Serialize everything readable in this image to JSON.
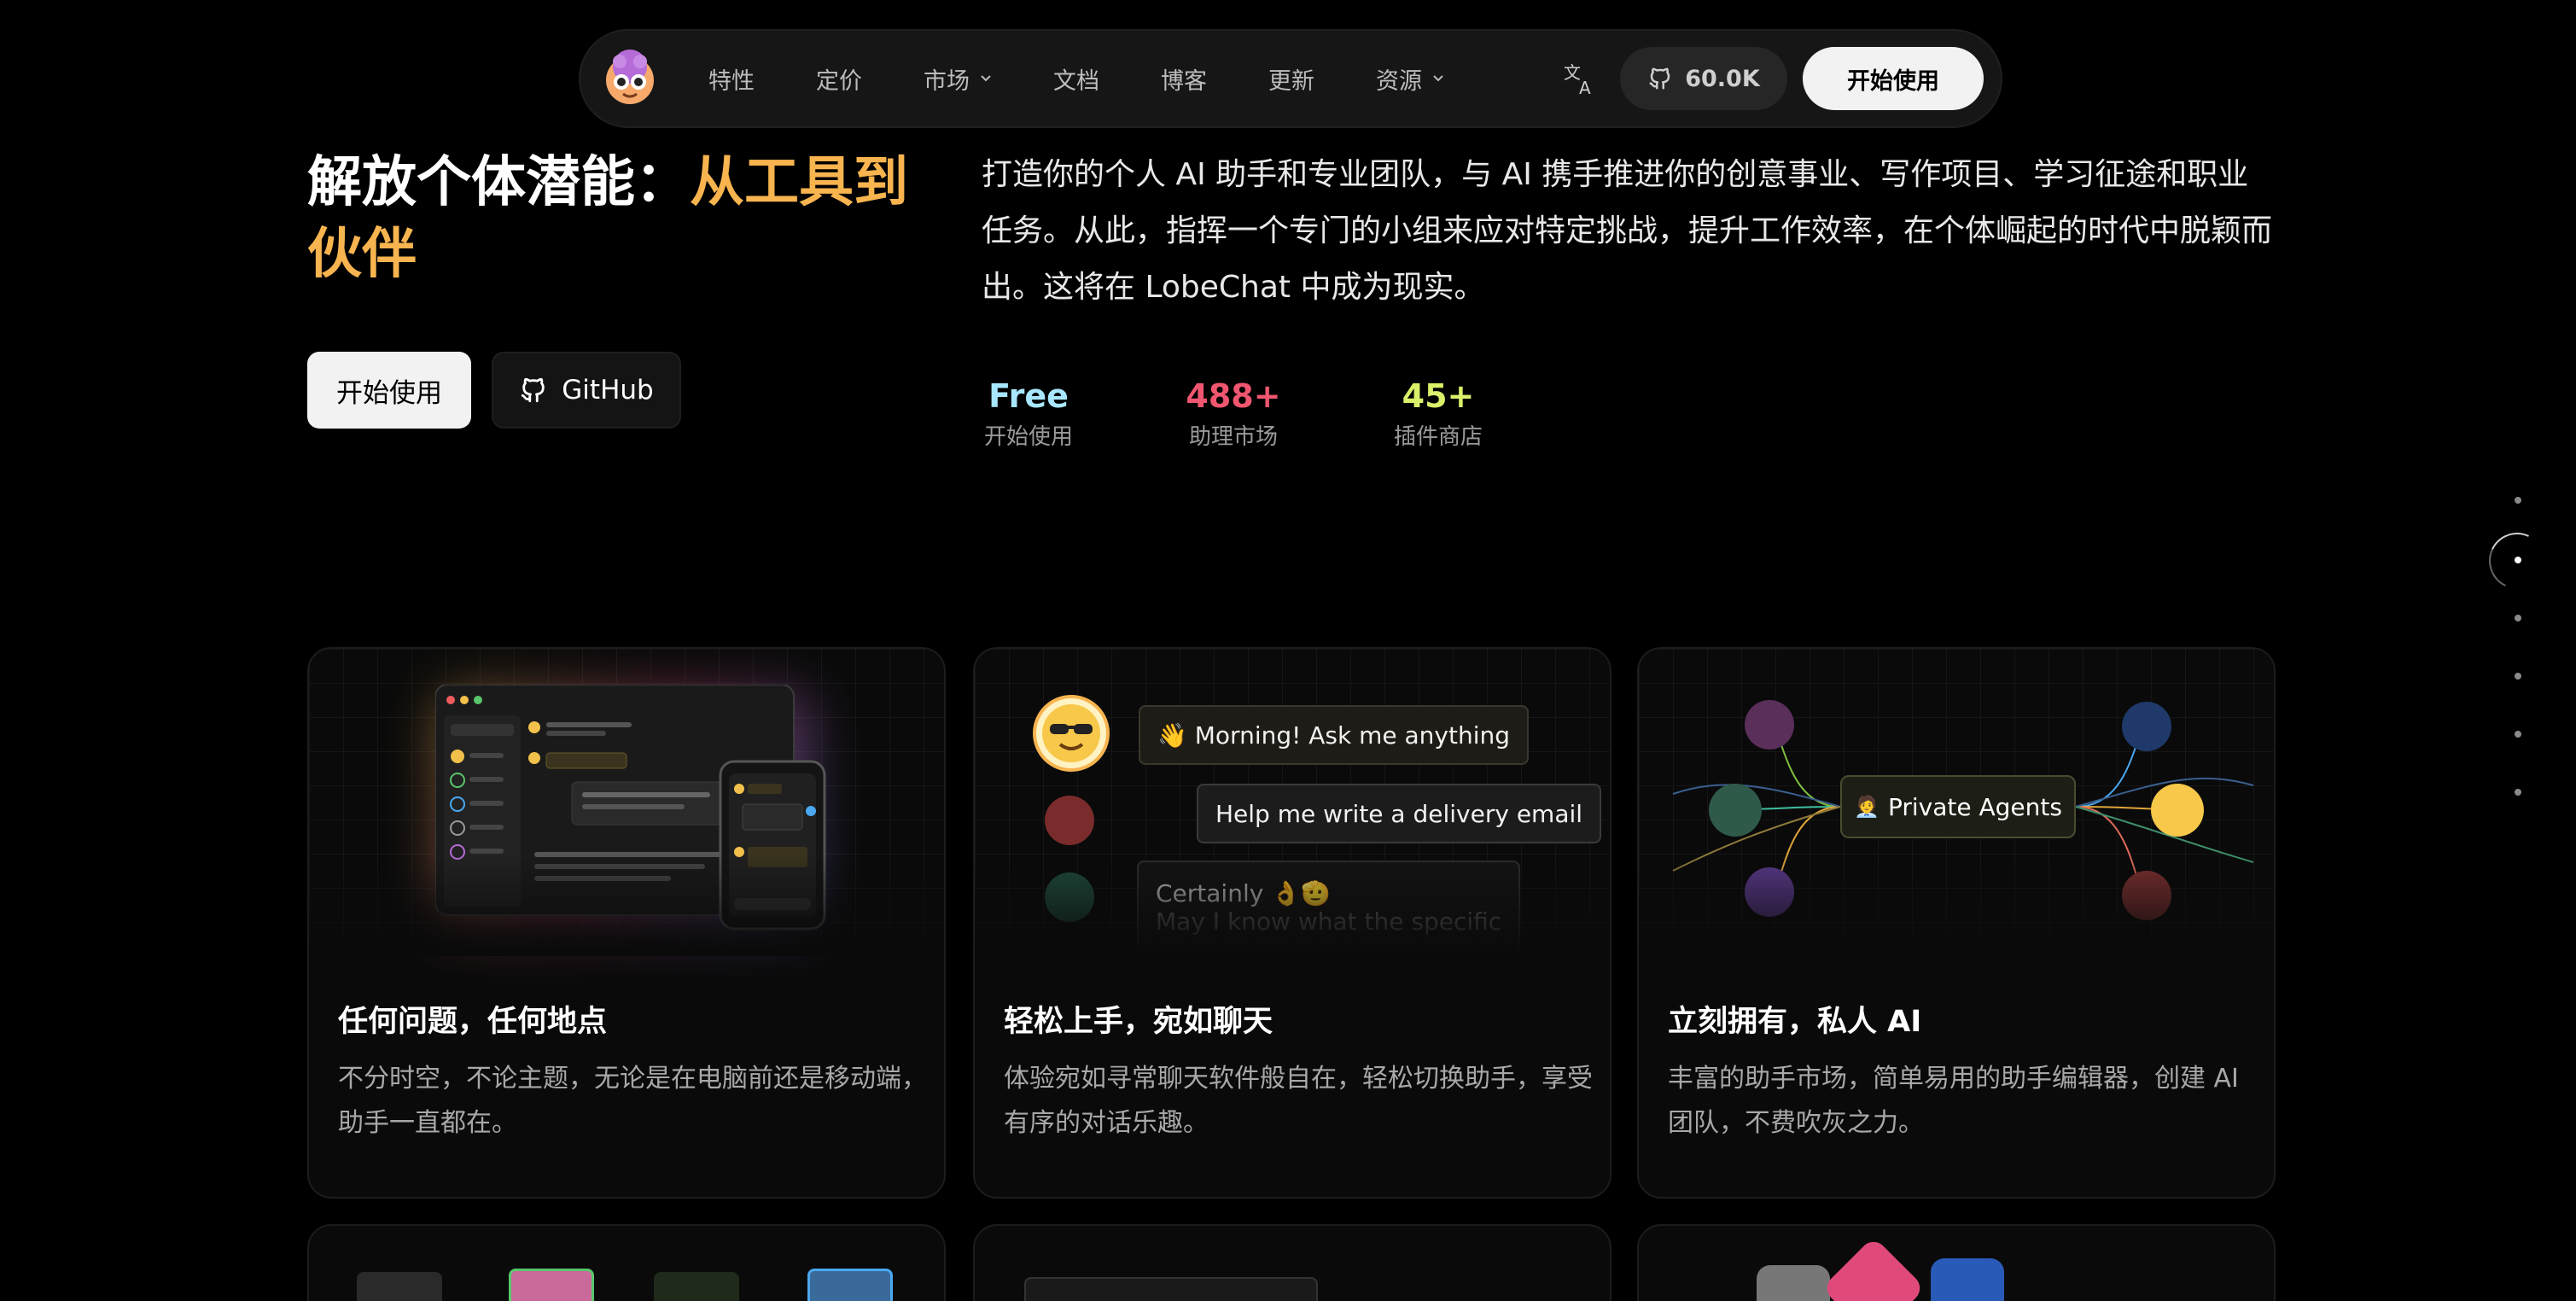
{
  "nav": {
    "links": [
      {
        "label": "特性",
        "dropdown": false
      },
      {
        "label": "定价",
        "dropdown": false
      },
      {
        "label": "市场",
        "dropdown": true
      },
      {
        "label": "文档",
        "dropdown": false
      },
      {
        "label": "博客",
        "dropdown": false
      },
      {
        "label": "更新",
        "dropdown": false
      },
      {
        "label": "资源",
        "dropdown": true
      }
    ],
    "stars": "60.0K",
    "start_label": "开始使用"
  },
  "hero": {
    "title_white": "解放个体潜能：",
    "title_accent": "从工具到伙伴",
    "primary_btn": "开始使用",
    "github_btn": "GitHub",
    "description": "打造你的个人 AI 助手和专业团队，与 AI 携手推进你的创意事业、写作项目、学习征途和职业任务。从此，指挥一个专门的小组来应对特定挑战，提升工作效率，在个体崛起的时代中脱颖而出。这将在 LobeChat 中成为现实。"
  },
  "stats": [
    {
      "value": "Free",
      "label": "开始使用",
      "color": "#a8e7ff"
    },
    {
      "value": "488+",
      "label": "助理市场",
      "color": "#f0566f"
    },
    {
      "value": "45+",
      "label": "插件商店",
      "color": "#d9f06a"
    }
  ],
  "cards": [
    {
      "title": "任何问题，任何地点",
      "desc": "不分时空，不论主题，无论是在电脑前还是移动端，助手一直都在。"
    },
    {
      "title": "轻松上手，宛如聊天",
      "desc": "体验宛如寻常聊天软件般自在，轻松切换助手，享受有序的对话乐趣。"
    },
    {
      "title": "立刻拥有，私人 AI",
      "desc": "丰富的助手市场，简单易用的助手编辑器，创建 AI 团队，不费吹灰之力。"
    }
  ],
  "chat_demo": {
    "msg1": "👋 Morning! Ask me anything",
    "msg2": "Help me write a delivery email",
    "msg3": "Certainly 👌🫡",
    "msg3_sub": "May I know what the specific"
  },
  "agents_demo": {
    "label": "Private Agents"
  },
  "colors": {
    "accent": "#f7b44f",
    "background": "#000000"
  }
}
